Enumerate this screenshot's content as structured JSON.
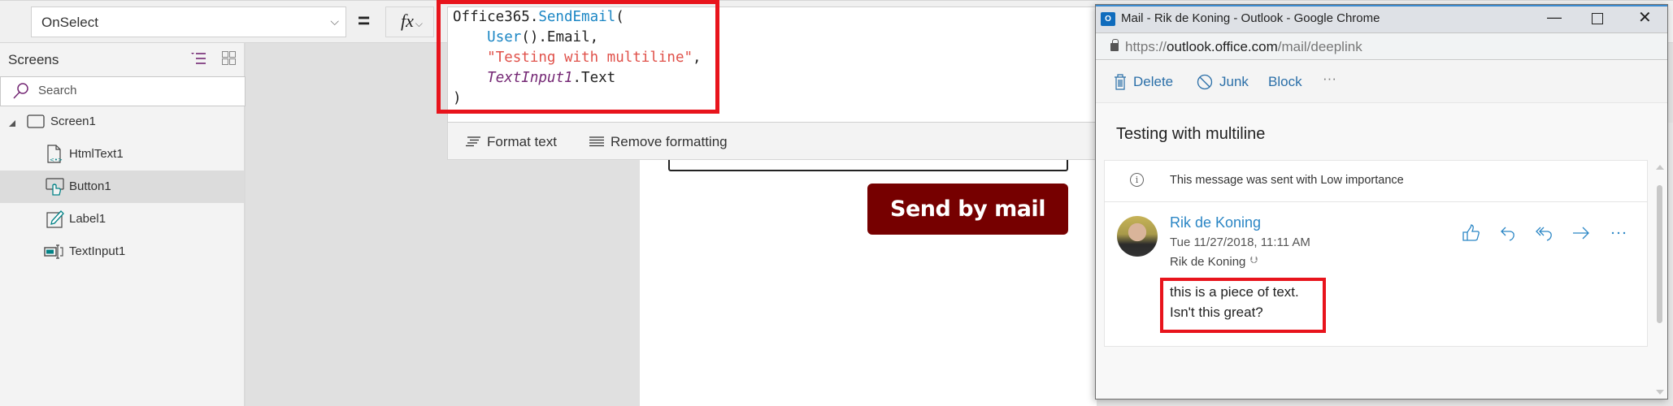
{
  "formula_bar": {
    "property": "OnSelect",
    "equals": "=",
    "fx_label": "fx",
    "code_lines": [
      {
        "parts": [
          {
            "t": "Office365.",
            "k": "plain"
          },
          {
            "t": "SendEmail",
            "k": "fn"
          },
          {
            "t": "(",
            "k": "plain"
          }
        ]
      },
      {
        "parts": [
          {
            "t": "    ",
            "k": "plain"
          },
          {
            "t": "User",
            "k": "fn"
          },
          {
            "t": "().Email,",
            "k": "plain"
          }
        ]
      },
      {
        "parts": [
          {
            "t": "    ",
            "k": "plain"
          },
          {
            "t": "\"Testing with multiline\"",
            "k": "str"
          },
          {
            "t": ",",
            "k": "plain"
          }
        ]
      },
      {
        "parts": [
          {
            "t": "    ",
            "k": "plain"
          },
          {
            "t": "TextInput1",
            "k": "ctl"
          },
          {
            "t": ".Text",
            "k": "plain"
          }
        ]
      },
      {
        "parts": [
          {
            "t": ")",
            "k": "plain"
          }
        ]
      }
    ],
    "format_text_label": "Format text",
    "remove_formatting_label": "Remove formatting"
  },
  "left_panel": {
    "title": "Screens",
    "search_placeholder": "Search",
    "tree": [
      {
        "label": "Screen1",
        "icon": "screen-icon",
        "level": 0,
        "expanded": true,
        "selected": false
      },
      {
        "label": "HtmlText1",
        "icon": "html-text-icon",
        "level": 1,
        "selected": false
      },
      {
        "label": "Button1",
        "icon": "button-icon",
        "level": 1,
        "selected": true
      },
      {
        "label": "Label1",
        "icon": "label-icon",
        "level": 1,
        "selected": false
      },
      {
        "label": "TextInput1",
        "icon": "text-input-icon",
        "level": 1,
        "selected": false
      }
    ]
  },
  "canvas": {
    "button_label": "Send by mail",
    "button_color": "#760000"
  },
  "outlook": {
    "window_title": "Mail - Rik de Koning - Outlook - Google Chrome",
    "url_scheme": "https://",
    "url_domain": "outlook.office.com",
    "url_path": "/mail/deeplink",
    "actions": {
      "delete": "Delete",
      "junk": "Junk",
      "block": "Block",
      "more": "···"
    },
    "subject": "Testing with multiline",
    "info_text": "This message was sent with Low importance",
    "sender": "Rik de Koning",
    "date": "Tue 11/27/2018, 11:11 AM",
    "to": "Rik de Koning",
    "body_lines": [
      "this is a piece of text.",
      "Isn't this great?"
    ],
    "accent_color": "#2b86c5"
  },
  "highlight_color": "#e8141c"
}
